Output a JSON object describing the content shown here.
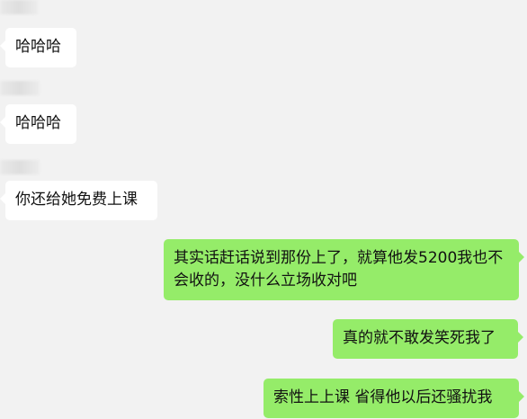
{
  "messages": [
    {
      "side": "left",
      "text": "哈哈哈"
    },
    {
      "side": "left",
      "text": "哈哈哈"
    },
    {
      "side": "left",
      "text": "你还给她免费上课"
    },
    {
      "side": "right",
      "text": "其实话赶话说到那份上了，就算他发5200我也不会收的，没什么立场收对吧"
    },
    {
      "side": "right",
      "text": "真的就不敢发笑死我了"
    },
    {
      "side": "right",
      "text": "索性上上课 省得他以后还骚扰我"
    }
  ],
  "colors": {
    "background": "#f2f2f2",
    "incoming_bubble": "#ffffff",
    "outgoing_bubble": "#95ec69"
  }
}
